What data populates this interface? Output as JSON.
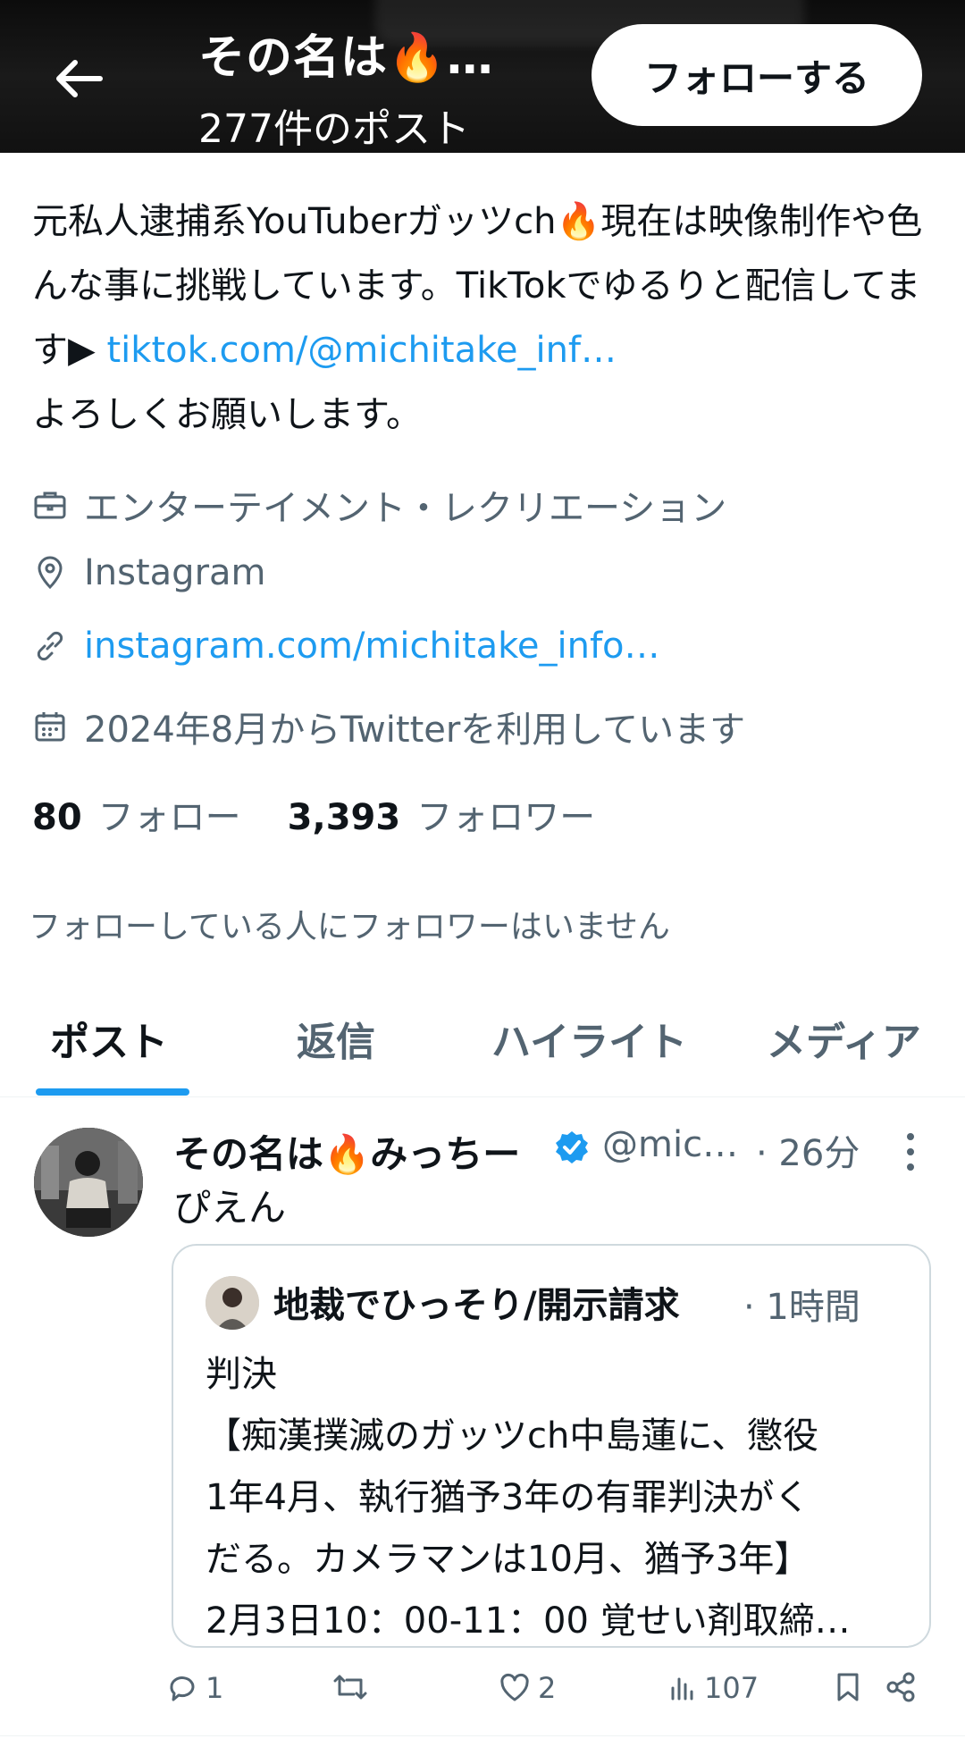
{
  "header": {
    "title": "その名は🔥…",
    "post_count": "277件のポスト",
    "follow_label": "フォローする"
  },
  "bio": {
    "text_1": "元私人逮捕系YouTuberガッツch🔥現在は映像制作や色んな事に挑戦しています。TikTokでゆるりと配信してます▶",
    "link": "tiktok.com/@michitake_inf…",
    "text_2": "よろしくお願いします。"
  },
  "meta": {
    "category": "エンターテイメント・レクリエーション",
    "location": "Instagram",
    "website": "instagram.com/michitake_info…",
    "joined": "2024年8月からTwitterを利用しています"
  },
  "stats": {
    "following_count": "80",
    "following_label": "フォロー",
    "followers_count": "3,393",
    "followers_label": "フォロワー"
  },
  "mutuals_note": "フォローしている人にフォロワーはいません",
  "tabs": [
    {
      "label": "ポスト"
    },
    {
      "label": "返信"
    },
    {
      "label": "ハイライト"
    },
    {
      "label": "メディア"
    }
  ],
  "post": {
    "name": "その名は🔥みっちー",
    "handle": "@mic…",
    "time": "· 26分",
    "text": "ぴえん",
    "quote": {
      "name": "地裁でひっそり/開示請求",
      "time": "· 1時間",
      "lines": [
        "判決",
        "【痴漢撲滅のガッツch中島蓮に、懲役",
        "1年4月、執行猶予3年の有罪判決がく",
        "だる。カメラマンは10月、猶予3年】",
        "2月3日10：00-11：00 覚せい剤取締…"
      ]
    },
    "actions": {
      "replies": "1",
      "likes": "2",
      "views": "107"
    }
  },
  "colors": {
    "accent": "#1d9bf0",
    "secondary_text": "#536471",
    "primary_text": "#0f1419"
  }
}
